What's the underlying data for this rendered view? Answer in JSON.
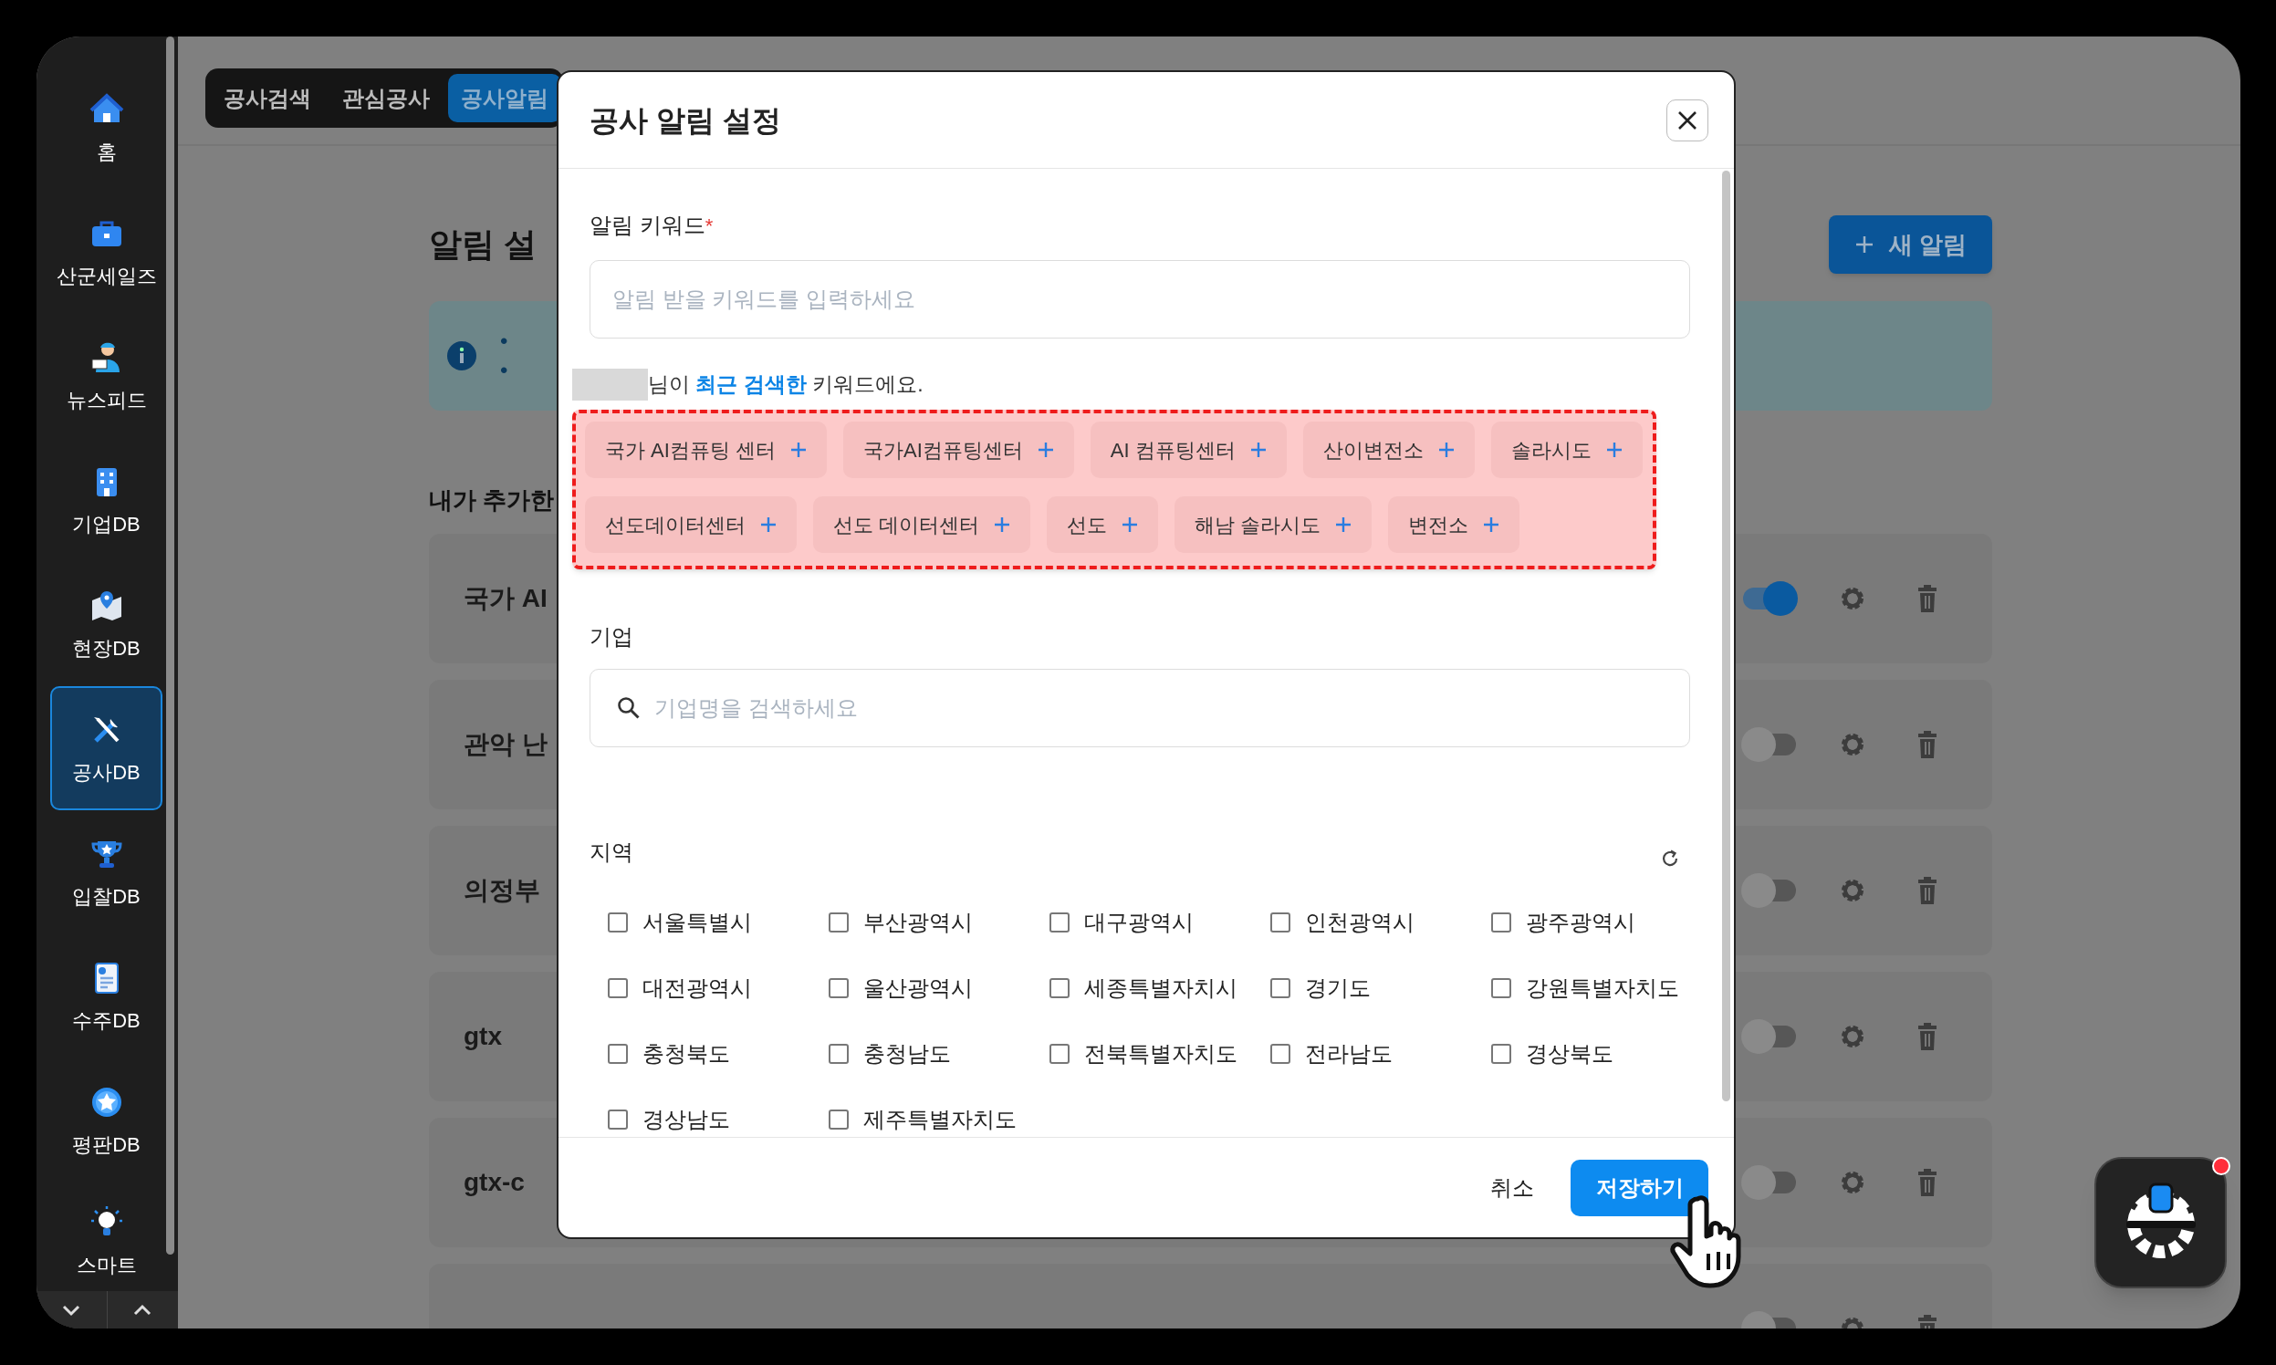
{
  "sidebar": {
    "items": [
      {
        "label": "홈",
        "selected": false
      },
      {
        "label": "산군세일즈",
        "selected": false
      },
      {
        "label": "뉴스피드",
        "selected": false
      },
      {
        "label": "기업DB",
        "selected": false
      },
      {
        "label": "현장DB",
        "selected": false
      },
      {
        "label": "공사DB",
        "selected": true
      },
      {
        "label": "입찰DB",
        "selected": false
      },
      {
        "label": "수주DB",
        "selected": false
      },
      {
        "label": "평판DB",
        "selected": false
      },
      {
        "label": "스마트",
        "selected": false
      }
    ]
  },
  "tabs": [
    {
      "label": "공사검색",
      "selected": false
    },
    {
      "label": "관심공사",
      "selected": false
    },
    {
      "label": "공사알림",
      "selected": true
    }
  ],
  "page": {
    "heading": "알림 설",
    "new_button": "새 알림",
    "info_bullets": [
      "•",
      "•"
    ],
    "section_title": "내가 추가한",
    "alerts": [
      {
        "title": "국가 AI",
        "on": true
      },
      {
        "title": "관악 난",
        "on": false
      },
      {
        "title": "의정부",
        "on": false
      },
      {
        "title": "gtx",
        "on": false
      },
      {
        "title": "gtx-c",
        "on": false
      },
      {
        "on": false
      }
    ]
  },
  "modal": {
    "title": "공사 알림 설정",
    "keyword_label": "알림 키워드",
    "required_mark": "*",
    "keyword_placeholder": "알림 받을 키워드를 입력하세요",
    "recent_text": "님이 **최근 검색한** 키워드에요.",
    "recent_keywords": [
      "국가 AI컴퓨팅 센터",
      "국가AI컴퓨팅센터",
      "AI 컴퓨팅센터",
      "산이변전소",
      "솔라시도",
      "선도데이터센터",
      "선도 데이터센터",
      "선도",
      "해남 솔라시도",
      "변전소"
    ],
    "company_label": "기업",
    "company_placeholder": "기업명을 검색하세요",
    "region_label": "지역",
    "regions": [
      {
        "label": "서울특별시",
        "checked": false
      },
      {
        "label": "부산광역시",
        "checked": false
      },
      {
        "label": "대구광역시",
        "checked": false
      },
      {
        "label": "인천광역시",
        "checked": false
      },
      {
        "label": "광주광역시",
        "checked": false
      },
      {
        "label": "대전광역시",
        "checked": false
      },
      {
        "label": "울산광역시",
        "checked": false
      },
      {
        "label": "세종특별자치시",
        "checked": false
      },
      {
        "label": "경기도",
        "checked": false
      },
      {
        "label": "강원특별자치도",
        "checked": false
      },
      {
        "label": "충청북도",
        "checked": false
      },
      {
        "label": "충청남도",
        "checked": false
      },
      {
        "label": "전북특별자치도",
        "checked": false
      },
      {
        "label": "전라남도",
        "checked": false
      },
      {
        "label": "경상북도",
        "checked": false
      },
      {
        "label": "경상남도",
        "checked": false
      },
      {
        "label": "제주특별자치도",
        "checked": false
      }
    ],
    "cancel_button": "취소",
    "save_button": "저장하기"
  }
}
